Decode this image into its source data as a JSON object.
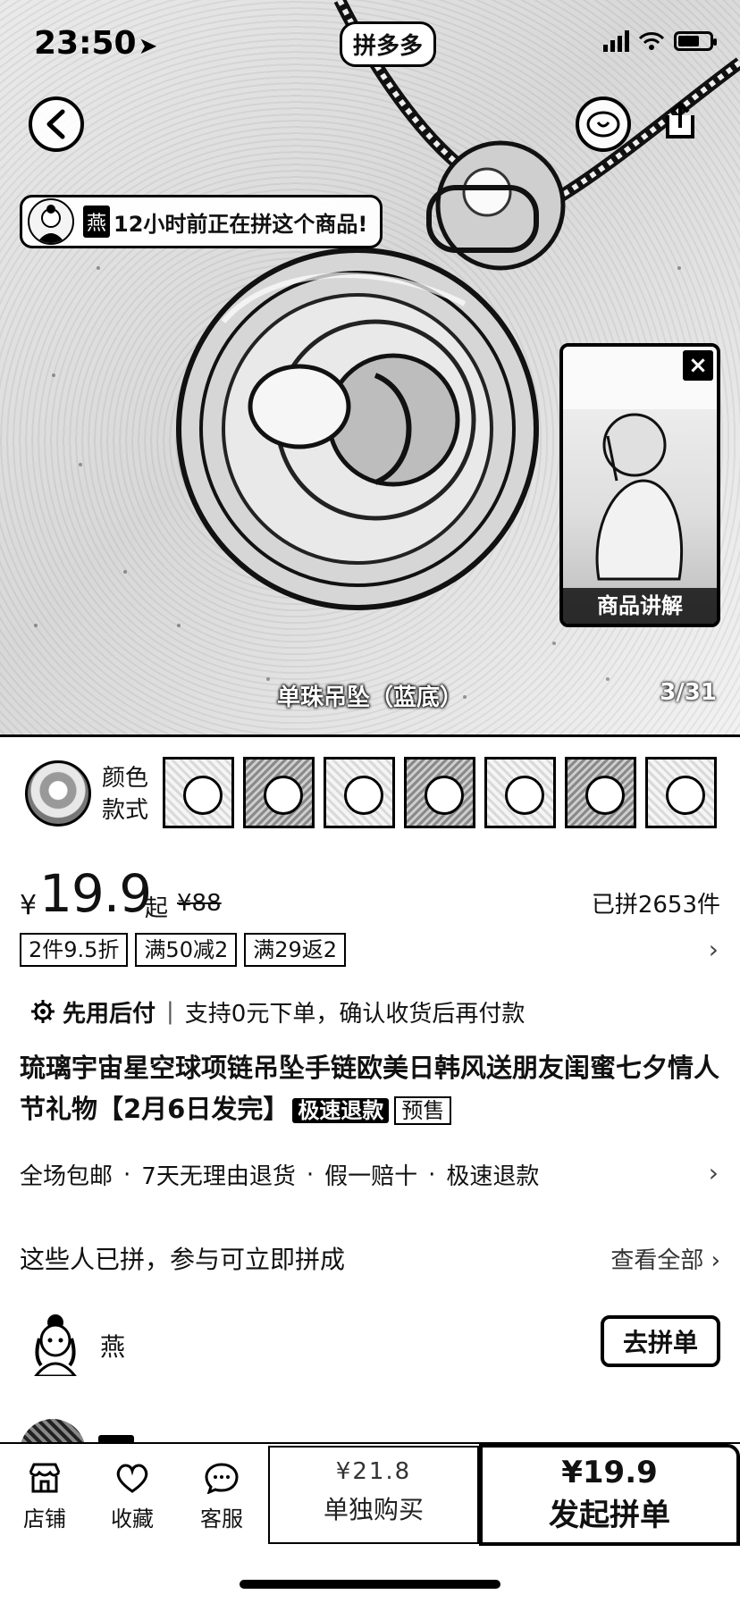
{
  "status_bar": {
    "time": "23:50",
    "app_name": "拼多多"
  },
  "hero": {
    "notice": {
      "name": "燕",
      "text": "12小时前正在拼这个商品!"
    },
    "video_label": "商品讲解",
    "caption": "单珠吊坠（蓝底）",
    "counter": "3/31"
  },
  "sku": {
    "label_line1": "颜色",
    "label_line2": "款式"
  },
  "price": {
    "currency": "¥",
    "value": "19.9",
    "suffix": "起",
    "original": "¥88",
    "sold": "已拼2653件"
  },
  "promotions": [
    "2件9.5折",
    "满50减2",
    "满29返2"
  ],
  "pay_later": {
    "title": "先用后付",
    "separator": "|",
    "text": "支持0元下单，确认收货后再付款"
  },
  "product": {
    "title": "琉璃宇宙星空球项链吊坠手链欧美日韩风送朋友闺蜜七夕情人节礼物【2月6日发完】",
    "badge_fast_refund": "极速退款",
    "badge_presale": "预售"
  },
  "services": [
    "全场包邮",
    "7天无理由退货",
    "假一赔十",
    "极速退款"
  ],
  "services_sep": "·",
  "group": {
    "heading": "这些人已拼，参与可立即拼成",
    "view_all": "查看全部",
    "user_name": "燕",
    "join_label": "去拼单"
  },
  "bottom_bar": {
    "store": "店铺",
    "favorite": "收藏",
    "service": "客服",
    "solo_price": "¥21.8",
    "solo_label": "单独购买",
    "group_price": "¥19.9",
    "group_label": "发起拼单"
  }
}
